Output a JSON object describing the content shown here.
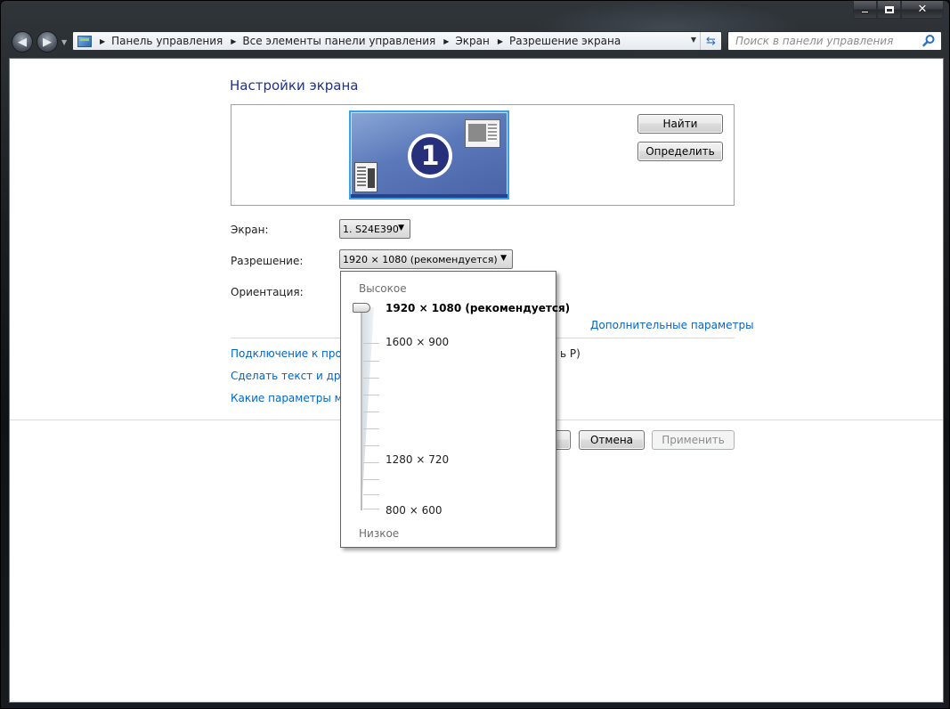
{
  "window": {
    "minimize_glyph": "—",
    "maximize_glyph": "□",
    "close_glyph": "✕"
  },
  "nav": {
    "back_glyph": "◀",
    "forward_glyph": "▶",
    "breadcrumb": [
      "Панель управления",
      "Все элементы панели управления",
      "Экран",
      "Разрешение экрана"
    ],
    "search_placeholder": "Поиск в панели управления"
  },
  "main": {
    "title": "Настройки экрана",
    "monitor_number": "1",
    "find_button": "Найти",
    "identify_button": "Определить",
    "screen_label": "Экран:",
    "screen_value": "1. S24E390",
    "resolution_label": "Разрешение:",
    "resolution_value": "1920 × 1080 (рекомендуется)",
    "orientation_label": "Ориентация:",
    "advanced_link": "Дополнительные параметры",
    "links": [
      "Подключение к проек",
      "Сделать текст и други",
      "Какие параметры мон"
    ],
    "link_tail": "ь P)",
    "cancel_button": "Отмена",
    "apply_button": "Применить"
  },
  "resolution_popup": {
    "high_label": "Высокое",
    "low_label": "Низкое",
    "options": [
      "1920 × 1080 (рекомендуется)",
      "1600 × 900",
      "1280 × 720",
      "800 × 600"
    ],
    "selected_index": 0
  },
  "colors": {
    "title_blue": "#1e3287",
    "link_blue": "#0066cc",
    "monitor_highlight": "#3aa0e8"
  },
  "icons": {
    "address": "control-panel-icon",
    "refresh": "refresh-icon",
    "search": "search-icon",
    "dropdown": "chevron-down-icon"
  }
}
